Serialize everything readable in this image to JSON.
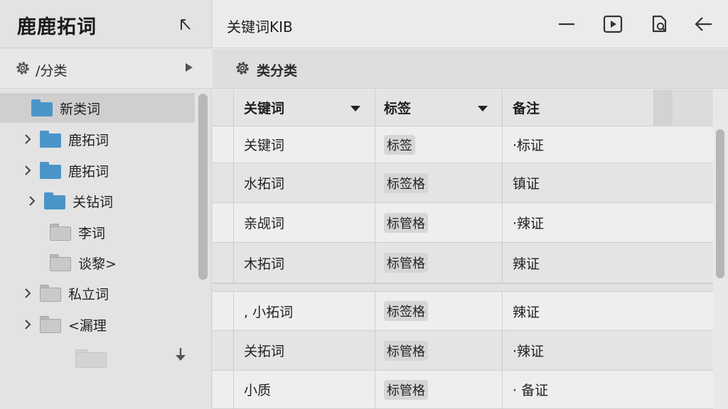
{
  "sidebar": {
    "app_title": "鹿鹿拓词",
    "path_label": "/分类",
    "tree": [
      {
        "label": "新类词",
        "folder": "blue",
        "selected": true,
        "chevron": false
      },
      {
        "label": "鹿拓词",
        "folder": "blue",
        "selected": false,
        "chevron": true
      },
      {
        "label": "鹿拓词",
        "folder": "blue",
        "selected": false,
        "chevron": true
      },
      {
        "label": "关钻词",
        "folder": "blue",
        "selected": false,
        "chevron": true
      },
      {
        "label": "李词",
        "folder": "grey",
        "selected": false,
        "chevron": false
      },
      {
        "label": "谈黎>",
        "folder": "grey",
        "selected": false,
        "chevron": false
      },
      {
        "label": "私立词",
        "folder": "grey",
        "selected": false,
        "chevron": true
      },
      {
        "label": "<漏理",
        "folder": "grey",
        "selected": false,
        "chevron": true
      }
    ]
  },
  "main": {
    "title": "关键词KIB",
    "toolbar_label": "类分类",
    "columns": [
      "关键词",
      "标签",
      "备注"
    ],
    "rows": [
      {
        "keyword": "关键词",
        "tag": "标签",
        "note": "·标证"
      },
      {
        "keyword": " 水拓词",
        "tag": "标签格",
        "note": "镇证"
      },
      {
        "keyword": "亲觇词",
        "tag": "标管格",
        "note": "·辣证"
      },
      {
        "keyword": "木拓词",
        "tag": "标管格",
        "note": "辣证"
      },
      {
        "keyword": ", 小拓词",
        "tag": "标签格",
        "note": "辣证"
      },
      {
        "keyword": "关拓词",
        "tag": "标管格",
        "note": "·辣证"
      },
      {
        "keyword": "小质",
        "tag": "标管格",
        "note": "· 备证"
      }
    ]
  },
  "icons": {
    "collapse": "collapse-sidebar-icon",
    "gear": "gear-icon",
    "minimize": "minimize-icon",
    "play": "play-panel-icon",
    "search": "search-file-icon",
    "back": "back-arrow-icon",
    "down": "down-arrow-icon"
  },
  "colors": {
    "folder_blue": "#4a95c8",
    "selected_bg": "#cfcfcf"
  }
}
